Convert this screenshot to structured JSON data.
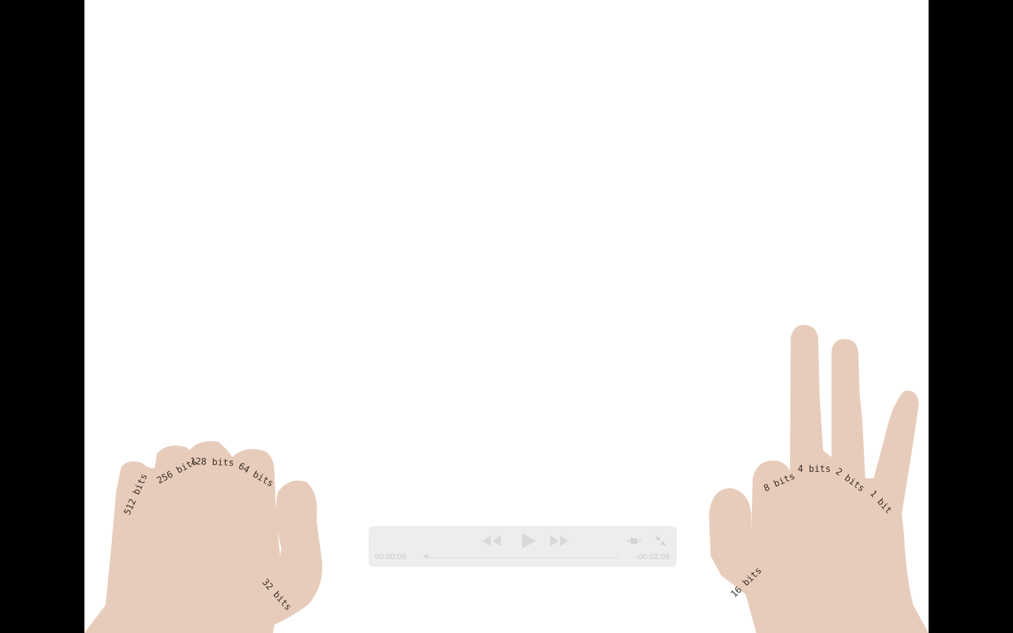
{
  "colors": {
    "skin": "#e8ccbb",
    "label": "#3a3028",
    "frame_background": "#ffffff",
    "letterbox": "#000000",
    "hud_background": "#ececec",
    "hud_icon": "#d9d9d9"
  },
  "left_hand": {
    "fingers": [
      {
        "label": "512 bits"
      },
      {
        "label": "256 bits"
      },
      {
        "label": "128 bits"
      },
      {
        "label": "64 bits"
      },
      {
        "label": "32 bits"
      }
    ]
  },
  "right_hand": {
    "fingers": [
      {
        "label": "16 bits"
      },
      {
        "label": "8 bits"
      },
      {
        "label": "4 bits"
      },
      {
        "label": "2 bits"
      },
      {
        "label": "1 bit"
      }
    ]
  },
  "player": {
    "elapsed": "00:00:06",
    "remaining": "-00:02:09",
    "icons": {
      "rewind": "rewind-icon",
      "play": "play-icon",
      "fast_forward": "fast-forward-icon",
      "volume": "volume-icon",
      "fullscreen": "fullscreen-exit-icon"
    }
  }
}
